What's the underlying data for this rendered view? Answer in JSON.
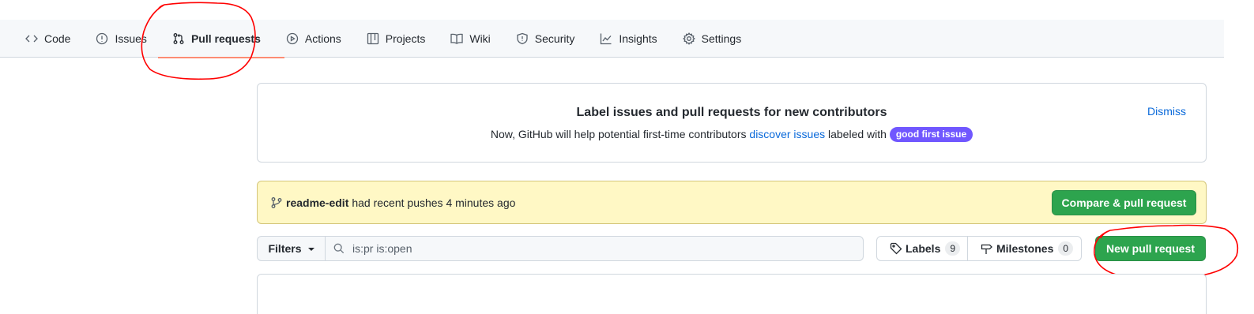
{
  "nav": {
    "tabs": [
      {
        "label": "Code",
        "icon": "code-icon"
      },
      {
        "label": "Issues",
        "icon": "issue-opened-icon"
      },
      {
        "label": "Pull requests",
        "icon": "git-pull-request-icon",
        "active": true
      },
      {
        "label": "Actions",
        "icon": "play-icon"
      },
      {
        "label": "Projects",
        "icon": "table-icon"
      },
      {
        "label": "Wiki",
        "icon": "book-icon"
      },
      {
        "label": "Security",
        "icon": "shield-icon"
      },
      {
        "label": "Insights",
        "icon": "graph-icon"
      },
      {
        "label": "Settings",
        "icon": "gear-icon"
      }
    ]
  },
  "banner": {
    "title": "Label issues and pull requests for new contributors",
    "text_before": "Now, GitHub will help potential first-time contributors ",
    "link": "discover issues",
    "text_after": " labeled with ",
    "label_badge": "good first issue",
    "dismiss": "Dismiss"
  },
  "flash": {
    "branch": "readme-edit",
    "message": "had recent pushes 4 minutes ago",
    "button": "Compare & pull request"
  },
  "toolbar": {
    "filters_label": "Filters",
    "search_value": "is:pr is:open",
    "labels_label": "Labels",
    "labels_count": "9",
    "milestones_label": "Milestones",
    "milestones_count": "0",
    "new_pr_button": "New pull request"
  },
  "colors": {
    "primary_button": "#2da44e",
    "link": "#0969da",
    "good_first_issue": "#7057ff",
    "annotation": "#ff0000",
    "active_tab_underline": "#fd8c73"
  }
}
